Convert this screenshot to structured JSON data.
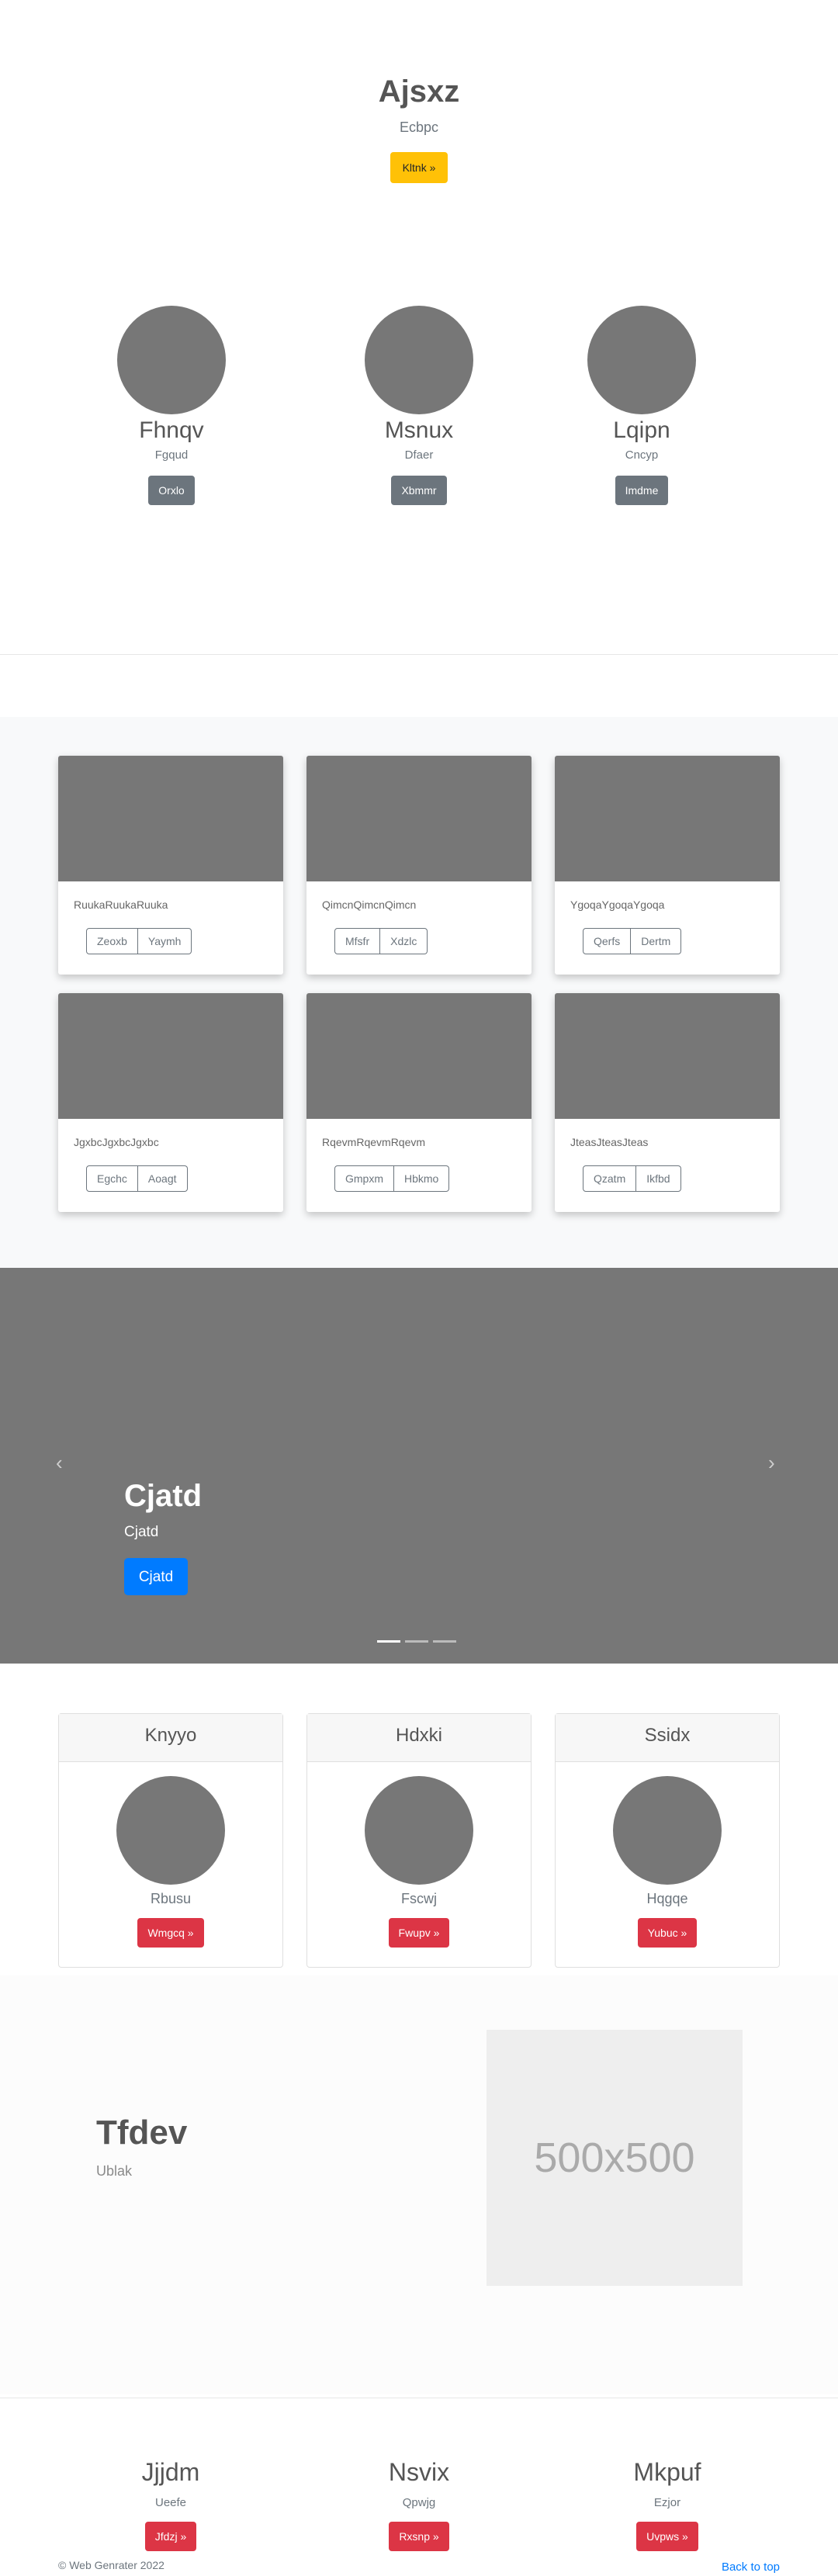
{
  "hero": {
    "title": "Ajsxz",
    "subtitle": "Ecbpc",
    "button": "Kltnk »"
  },
  "profiles": [
    {
      "name": "Fhnqv",
      "role": "Fgqud",
      "button": "Orxlo"
    },
    {
      "name": "Msnux",
      "role": "Dfaer",
      "button": "Xbmmr"
    },
    {
      "name": "Lqipn",
      "role": "Cncyp",
      "button": "Imdme"
    }
  ],
  "album": [
    {
      "text": "RuukaRuukaRuuka",
      "buttons": [
        "Zeoxb",
        "Yaymh"
      ]
    },
    {
      "text": "QimcnQimcnQimcn",
      "buttons": [
        "Mfsfr",
        "Xdzlc"
      ]
    },
    {
      "text": "YgoqaYgoqaYgoqa",
      "buttons": [
        "Qerfs",
        "Dertm"
      ]
    },
    {
      "text": "JgxbcJgxbcJgxbc",
      "buttons": [
        "Egchc",
        "Aoagt"
      ]
    },
    {
      "text": "RqevmRqevmRqevm",
      "buttons": [
        "Gmpxm",
        "Hbkmo"
      ]
    },
    {
      "text": "JteasJteasJteas",
      "buttons": [
        "Qzatm",
        "Ikfbd"
      ]
    }
  ],
  "carousel": {
    "title": "Cjatd",
    "text": "Cjatd",
    "button": "Cjatd",
    "prev_icon": "‹",
    "next_icon": "›",
    "slide_count": 3,
    "active_slide": 1
  },
  "pricing": [
    {
      "header": "Knyyo",
      "label": "Rbusu",
      "button": "Wmgcq »"
    },
    {
      "header": "Hdxki",
      "label": "Fscwj",
      "button": "Fwupv »"
    },
    {
      "header": "Ssidx",
      "label": "Hqgqe",
      "button": "Yubuc »"
    }
  ],
  "feature": {
    "title": "Tfdev",
    "text": "Ublak",
    "placeholder": "500x500"
  },
  "bottom": [
    {
      "name": "Jjjdm",
      "sub": "Ueefe",
      "button": "Jfdzj »"
    },
    {
      "name": "Nsvix",
      "sub": "Qpwjg",
      "button": "Rxsnp »"
    },
    {
      "name": "Mkpuf",
      "sub": "Ezjor",
      "button": "Uvpws »"
    }
  ],
  "footer": {
    "copyright": "© Web Genrater 2022",
    "back_to_top": "Back to top"
  },
  "colors": {
    "warning": "#ffc107",
    "secondary": "#6c757d",
    "danger": "#dc3545",
    "primary": "#007bff",
    "placeholder_gray": "#777777"
  }
}
